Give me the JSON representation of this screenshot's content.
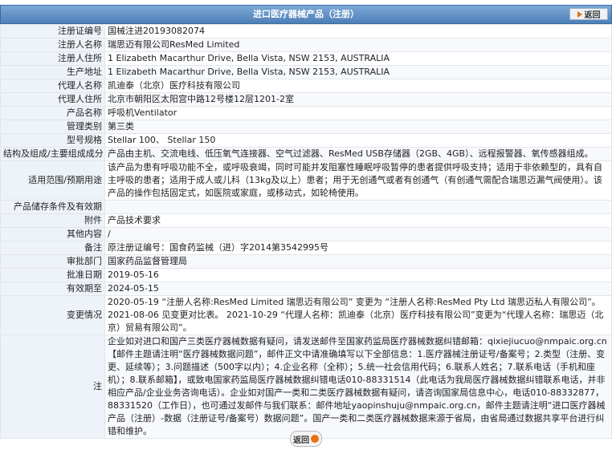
{
  "header": {
    "title": "进口医疗器械产品（注册）",
    "back_label": "返回"
  },
  "rows": [
    {
      "label": "注册证编号",
      "value": "国械注进20193082074"
    },
    {
      "label": "注册人名称",
      "value": "瑞思迈有限公司ResMed Limited"
    },
    {
      "label": "注册人住所",
      "value": "1 Elizabeth Macarthur Drive, Bella Vista, NSW 2153, AUSTRALIA"
    },
    {
      "label": "生产地址",
      "value": "1 Elizabeth Macarthur Drive, Bella Vista, NSW 2153, AUSTRALIA"
    },
    {
      "label": "代理人名称",
      "value": "凯迪泰（北京）医疗科技有限公司"
    },
    {
      "label": "代理人住所",
      "value": "北京市朝阳区太阳宫中路12号楼12层1201-2室"
    },
    {
      "label": "产品名称",
      "value": "呼吸机Ventilator"
    },
    {
      "label": "管理类别",
      "value": "第三类"
    },
    {
      "label": "型号规格",
      "value": "Stellar 100、 Stellar 150"
    },
    {
      "label": "结构及组成/主要组成成分",
      "value": "产品由主机、交流电线、低压氧气连接器、空气过滤器、ResMed USB存储器（2GB、4GB）、远程报警器、氧传感器组成。"
    },
    {
      "label": "适用范围/预期用途",
      "value": "该产品为患有呼吸功能不全，或呼吸衰竭，同时可能并发阻塞性睡眠呼吸暂停的患者提供呼吸支持；适用于非依赖型的，具有自主呼吸的患者；适用于成人或儿科（13kg及以上）患者；用于无创通气或者有创通气（有创通气需配合瑞思迈漏气阀使用）。该产品的操作包括固定式，如医院或家庭，或移动式，如轮椅使用。"
    },
    {
      "label": "产品储存条件及有效期",
      "value": ""
    },
    {
      "label": "附件",
      "value": "产品技术要求"
    },
    {
      "label": "其他内容",
      "value": "/"
    },
    {
      "label": "备注",
      "value": "原注册证编号：国食药监械（进）字2014第3542995号"
    },
    {
      "label": "审批部门",
      "value": "国家药品监督管理局"
    },
    {
      "label": "批准日期",
      "value": "2019-05-16"
    },
    {
      "label": "有效期至",
      "value": "2024-05-15"
    },
    {
      "label": "变更情况",
      "value": "2020-05-19 “注册人名称:ResMed Limited 瑞思迈有限公司” 变更为 “注册人名称:ResMed Pty Ltd 瑞思迈私人有限公司”。 2021-08-06 见变更对比表。 2021-10-29 “代理人名称：凯迪泰（北京）医疗科技有限公司”变更为“代理人名称：瑞思迈（北京）贸易有限公司”。"
    },
    {
      "label": "注",
      "value": "企业如对进口和国产三类医疗器械数据有疑问，请发送邮件至国家药监局医疗器械数据纠错邮箱：qixiejiucuo@nmpaic.org.cn【邮件主题请注明“医疗器械数据问题”，邮件正文中请准确填写以下全部信息：1.医疗器械注册证号/备案号；2.类型（注册、变更、延续等）；3.问题描述（500字以内）；4.企业名称（全称）；5.统一社会信用代码；6.联系人姓名；7.联系电话（手机和座机）；8.联系邮箱】，或致电国家药监局医疗器械数据纠错电话010-88331514（此电话为我局医疗器械数据纠错联系电话，并非相应产品/企业业务咨询电话）。企业如对国产一类和二类医疗器械数据有疑问，请咨询国家局信息中心，电话010-88332877，88331520（工作日），也可通过发邮件与我们联系：邮件地址yaopinshuju@nmpaic.org.cn，邮件主题请注明“进口医疗器械产品（注册）-数据（注册证号/备案号）数据问题”。国产一类和二类医疗器械数据来源于省局，由省局通过数据共享平台进行纠错和维护。"
    }
  ],
  "footer": {
    "back_label": "返回"
  }
}
